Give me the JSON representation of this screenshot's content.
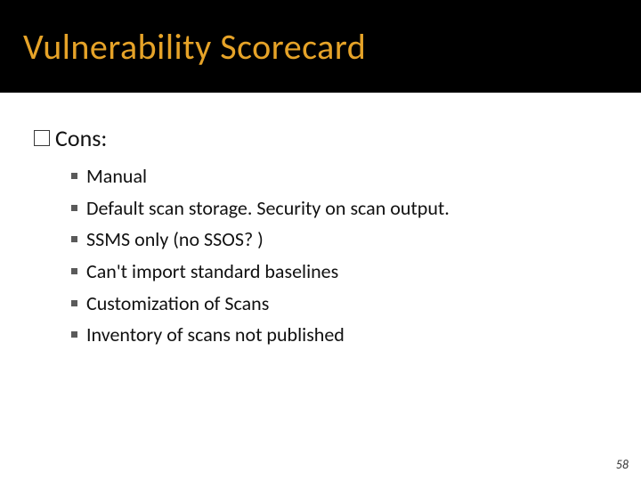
{
  "title": "Vulnerability Scorecard",
  "section": {
    "label": "Cons:"
  },
  "bullets": [
    {
      "text": "Manual"
    },
    {
      "text": "Default scan storage. Security on scan output."
    },
    {
      "text": "SSMS only (no SSOS? )"
    },
    {
      "text": "Can't import standard baselines"
    },
    {
      "text": "Customization of Scans"
    },
    {
      "text": "Inventory of scans not published"
    }
  ],
  "pageNumber": "58"
}
